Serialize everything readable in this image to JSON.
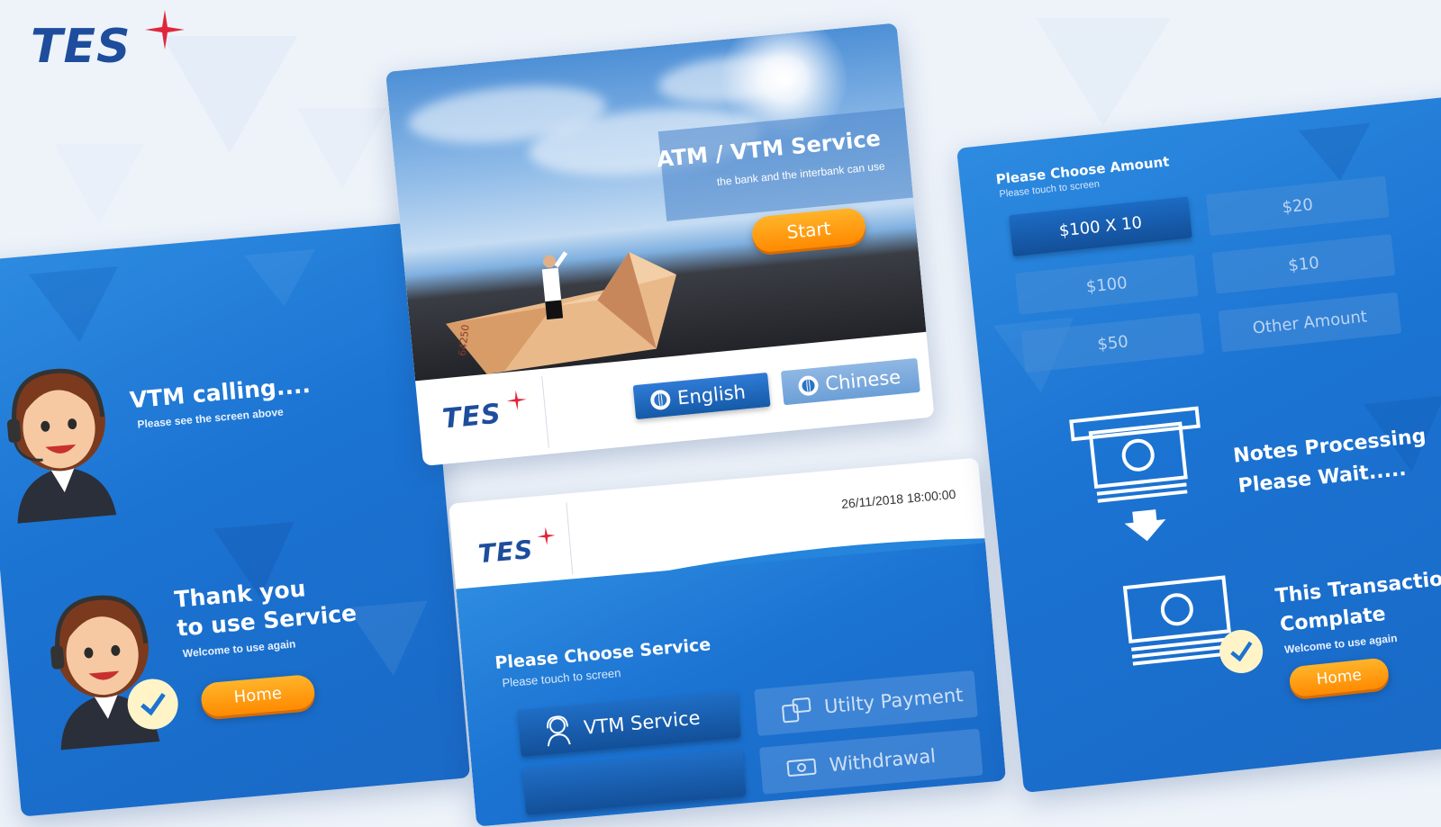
{
  "brand": {
    "logo_text": "TES"
  },
  "welcome": {
    "title": "ATM / VTM Service",
    "subtitle": "the bank and the interbank can use",
    "start_label": "Start",
    "lang_english": "English",
    "lang_chinese": "Chinese",
    "banknote_serial": "64250"
  },
  "service": {
    "datetime": "26/11/2018 18:00:00",
    "title": "Please Choose Service",
    "subtitle": "Please touch to screen",
    "buttons": [
      {
        "label": "VTM Service",
        "icon": "agent-icon"
      },
      {
        "label": "Utilty Payment",
        "icon": "payment-icon"
      },
      {
        "label": "Withdrawal",
        "icon": "cash-icon"
      }
    ]
  },
  "calling": {
    "title": "VTM calling....",
    "subtitle": "Please see the screen above"
  },
  "thankyou": {
    "title_line1": "Thank you",
    "title_line2": "to use Service",
    "subtitle": "Welcome to use again",
    "home_label": "Home"
  },
  "amount": {
    "title": "Please Choose Amount",
    "subtitle": "Please touch to screen",
    "options": [
      "$100 X 10",
      "$20",
      "$100",
      "$10",
      "$50",
      "Other Amount"
    ]
  },
  "processing": {
    "line1": "Notes Processing",
    "line2": "Please Wait....."
  },
  "complete": {
    "line1": "This Transaction",
    "line2": "Complate",
    "subtitle": "Welcome to use again",
    "home_label": "Home"
  },
  "colors": {
    "brand_blue": "#1d4d9c",
    "star_red": "#e0263a",
    "panel_blue": "#1b73d2",
    "button_orange": "#ff9a10"
  }
}
